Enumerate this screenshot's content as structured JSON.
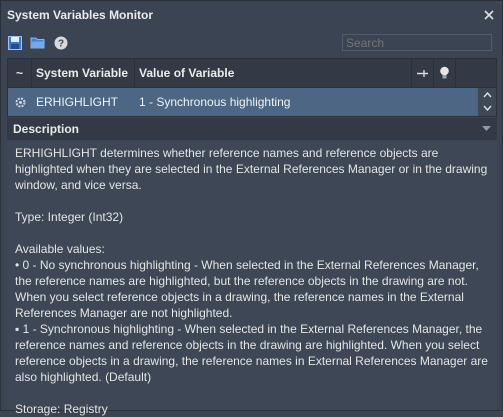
{
  "window": {
    "title": "System Variables Monitor"
  },
  "toolbar": {
    "search_placeholder": "Search"
  },
  "grid": {
    "columns": [
      "~",
      "System Variable",
      "Value of Variable"
    ],
    "rows": [
      {
        "name": "ERHIGHLIGHT",
        "value": "1 - Synchronous highlighting"
      }
    ]
  },
  "description": {
    "header": "Description",
    "summary": "ERHIGHLIGHT determines whether reference names and reference objects are highlighted when they are selected in the External References Manager or in the drawing window, and vice versa.",
    "type": "Type: Integer (Int32)",
    "available_label": "Available values:",
    "value0": "• 0 - No synchronous highlighting - When selected in the External References Manager, the reference names are highlighted, but the reference objects in the drawing are not. When you select reference objects in a drawing, the reference names in the External References Manager are not highlighted.",
    "value1": "▪ 1 - Synchronous highlighting - When selected in the External References Manager, the reference names and reference objects in the drawing are highlighted. When you select reference objects in a drawing, the reference names in External References Manager are also highlighted. (Default)",
    "storage": "Storage: Registry"
  },
  "colors": {
    "background": "#3b4453",
    "selected_row": "#4d6684",
    "header": "#333a46"
  }
}
